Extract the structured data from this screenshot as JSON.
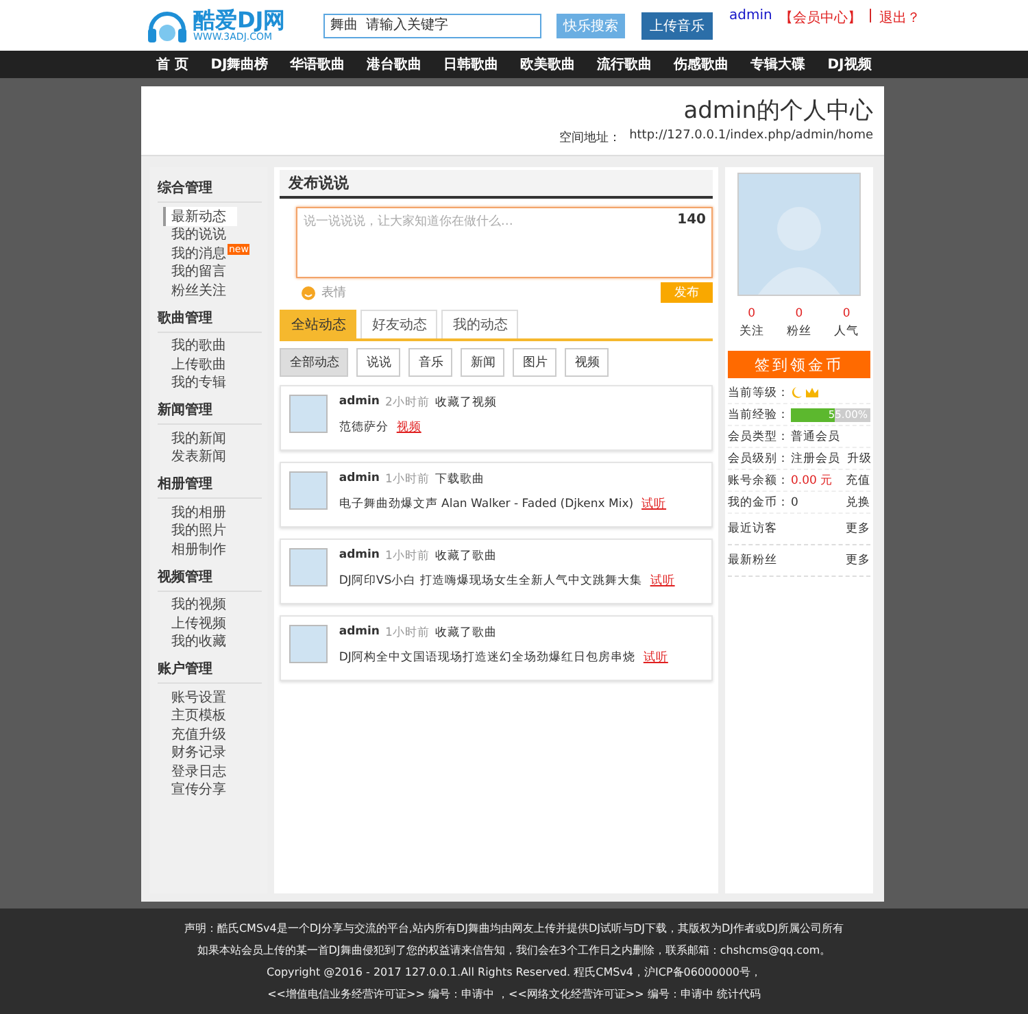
{
  "header": {
    "logo_text": "酷爱DJ网",
    "logo_url": "WWW.3ADJ.COM",
    "search_category": "舞曲",
    "search_placeholder": "请输入关键字",
    "search_button": "快乐搜索",
    "upload_button": "上传音乐",
    "user_link": "admin",
    "center_link": "【会员中心】",
    "separator": "|",
    "logout_link": "退出？"
  },
  "nav": [
    {
      "label": "首 页",
      "selected": false
    },
    {
      "label": "DJ舞曲榜",
      "selected": false
    },
    {
      "label": "华语歌曲",
      "selected": false
    },
    {
      "label": "港台歌曲",
      "selected": false
    },
    {
      "label": "日韩歌曲",
      "selected": false
    },
    {
      "label": "欧美歌曲",
      "selected": false
    },
    {
      "label": "流行歌曲",
      "selected": false
    },
    {
      "label": "伤感歌曲",
      "selected": false
    },
    {
      "label": "专辑大碟",
      "selected": false
    },
    {
      "label": "DJ视频",
      "selected": false
    }
  ],
  "page_title": "admin的个人中心",
  "space_label": "空间地址：",
  "space_url": "http://127.0.0.1/index.php/admin/home",
  "sidebar": [
    {
      "title": "综合管理",
      "items": [
        {
          "label": "最新动态",
          "selected": true
        },
        {
          "label": "我的说说",
          "selected": false
        },
        {
          "label": "我的消息",
          "selected": false,
          "badge": "new"
        },
        {
          "label": "我的留言",
          "selected": false
        },
        {
          "label": "粉丝关注",
          "selected": false
        }
      ]
    },
    {
      "title": "歌曲管理",
      "items": [
        {
          "label": "我的歌曲",
          "selected": false
        },
        {
          "label": "上传歌曲",
          "selected": false
        },
        {
          "label": "我的专辑",
          "selected": false
        }
      ]
    },
    {
      "title": "新闻管理",
      "items": [
        {
          "label": "我的新闻",
          "selected": false
        },
        {
          "label": "发表新闻",
          "selected": false
        }
      ]
    },
    {
      "title": "相册管理",
      "items": [
        {
          "label": "我的相册",
          "selected": false
        },
        {
          "label": "我的照片",
          "selected": false
        },
        {
          "label": "相册制作",
          "selected": false
        }
      ]
    },
    {
      "title": "视频管理",
      "items": [
        {
          "label": "我的视频",
          "selected": false
        },
        {
          "label": "上传视频",
          "selected": false
        },
        {
          "label": "我的收藏",
          "selected": false
        }
      ]
    },
    {
      "title": "账户管理",
      "items": [
        {
          "label": "账号设置",
          "selected": false
        },
        {
          "label": "主页模板",
          "selected": false
        },
        {
          "label": "充值升级",
          "selected": false
        },
        {
          "label": "财务记录",
          "selected": false
        },
        {
          "label": "登录日志",
          "selected": false
        },
        {
          "label": "宣传分享",
          "selected": false
        }
      ]
    }
  ],
  "post": {
    "title": "发布说说",
    "placeholder": "说一说说说，让大家知道你在做什么…",
    "counter": "140",
    "emoji_label": "表情",
    "submit": "发布"
  },
  "feed_tabs": [
    {
      "label": "全站动态",
      "selected": true
    },
    {
      "label": "好友动态",
      "selected": false
    },
    {
      "label": "我的动态",
      "selected": false
    }
  ],
  "filters": [
    {
      "label": "全部动态",
      "selected": true
    },
    {
      "label": "说说",
      "selected": false
    },
    {
      "label": "音乐",
      "selected": false
    },
    {
      "label": "新闻",
      "selected": false
    },
    {
      "label": "图片",
      "selected": false
    },
    {
      "label": "视频",
      "selected": false
    }
  ],
  "feed": [
    {
      "user": "admin",
      "time": "2小时前",
      "action": "收藏了视频",
      "text": "范德萨分",
      "link": "视频"
    },
    {
      "user": "admin",
      "time": "1小时前",
      "action": "下载歌曲",
      "text": "电子舞曲劲爆文声 Alan Walker - Faded (Djkenx Mix)",
      "link": "试听"
    },
    {
      "user": "admin",
      "time": "1小时前",
      "action": "收藏了歌曲",
      "text": "DJ阿印VS小白 打造嗨爆现场女生全新人气中文跳舞大集",
      "link": "试听"
    },
    {
      "user": "admin",
      "time": "1小时前",
      "action": "收藏了歌曲",
      "text": "DJ阿构全中文国语现场打造迷幻全场劲爆红日包房串烧",
      "link": "试听"
    }
  ],
  "profile": {
    "stats": [
      {
        "value": "0",
        "label": "关注"
      },
      {
        "value": "0",
        "label": "粉丝"
      },
      {
        "value": "0",
        "label": "人气"
      }
    ],
    "checkin": "签到领金币",
    "level_label": "当前等级：",
    "exp_label": "当前经验：",
    "exp_reading": "55.00%",
    "level": 0.55,
    "rows": [
      {
        "label": "会员类型：",
        "value": "普通会员",
        "action": ""
      },
      {
        "label": "会员级别：",
        "value": "注册会员",
        "action": "升级"
      },
      {
        "label": "账号余额：",
        "value": "0.00 元",
        "action": "充值",
        "red": true
      },
      {
        "label": "我的金币：",
        "value": "0",
        "action": "兑换",
        "red": false
      }
    ],
    "sections": [
      {
        "title": "最近访客",
        "more": "更多"
      },
      {
        "title": "最新粉丝",
        "more": "更多"
      }
    ]
  },
  "footer": [
    "声明：酷氏CMSv4是一个DJ分享与交流的平台,站内所有DJ舞曲均由网友上传并提供DJ试听与DJ下载，其版权为DJ作者或DJ所属公司所有",
    "如果本站会员上传的某一首DJ舞曲侵犯到了您的权益请来信告知，我们会在3个工作日之内删除，联系邮箱：chshcms@qq.com。",
    "Copyright @2016 - 2017 127.0.0.1.All Rights Reserved. 程氏CMSv4，沪ICP备06000000号，",
    "<<增值电信业务经营许可证>> 编号：申请中 ，<<网络文化经营许可证>> 编号：申请中 统计代码"
  ]
}
